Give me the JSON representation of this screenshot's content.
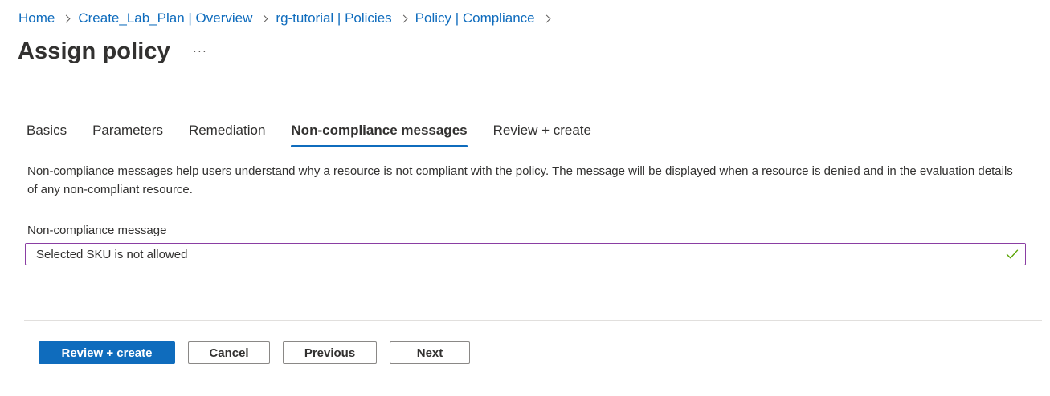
{
  "breadcrumb": {
    "items": [
      "Home",
      "Create_Lab_Plan | Overview",
      "rg-tutorial | Policies",
      "Policy | Compliance"
    ]
  },
  "header": {
    "title": "Assign policy",
    "more_label": "···"
  },
  "tabs": [
    {
      "label": "Basics",
      "active": false
    },
    {
      "label": "Parameters",
      "active": false
    },
    {
      "label": "Remediation",
      "active": false
    },
    {
      "label": "Non-compliance messages",
      "active": true
    },
    {
      "label": "Review + create",
      "active": false
    }
  ],
  "main": {
    "description": "Non-compliance messages help users understand why a resource is not compliant with the policy. The message will be displayed when a resource is denied and in the evaluation details of any non-compliant resource.",
    "field_label": "Non-compliance message",
    "field_value": "Selected SKU is not allowed",
    "field_status_icon": "checkmark-icon"
  },
  "footer": {
    "review_create_label": "Review + create",
    "cancel_label": "Cancel",
    "previous_label": "Previous",
    "next_label": "Next"
  },
  "colors": {
    "accent": "#0f6cbd",
    "field_border": "#8a3ea3",
    "valid_check": "#57a300"
  }
}
